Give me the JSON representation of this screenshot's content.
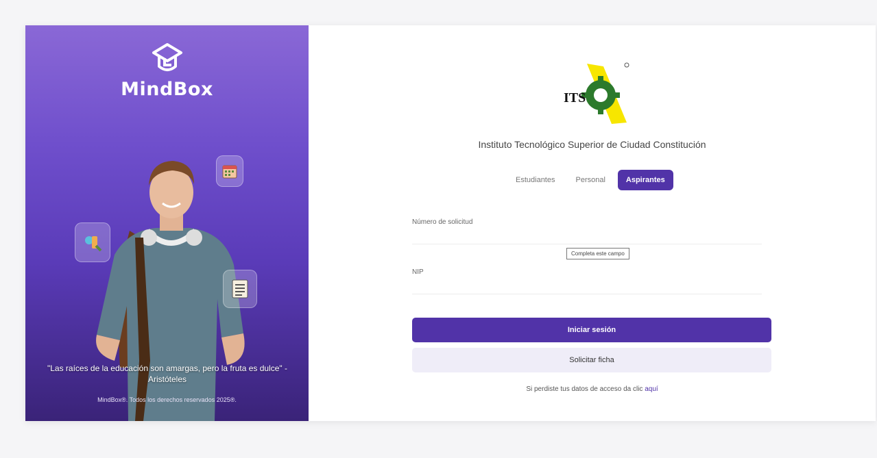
{
  "brand": {
    "name": "MindBox",
    "icon": "graduation-cap-icon"
  },
  "left_panel": {
    "quote": "\"Las raíces de la educación son amargas, pero la fruta es dulce\" - Aristóteles",
    "copyright": "MindBox®. Todos los derechos reservados 2025®.",
    "floating_icons": [
      "calendar-icon",
      "tools-icon",
      "checklist-icon"
    ]
  },
  "institution": {
    "logo_text": "ITS",
    "name": "Instituto Tecnológico Superior de Ciudad Constitución"
  },
  "tabs": [
    {
      "label": "Estudiantes",
      "active": false
    },
    {
      "label": "Personal",
      "active": false
    },
    {
      "label": "Aspirantes",
      "active": true
    }
  ],
  "form": {
    "solicitud_label": "Número de solicitud",
    "solicitud_value": "",
    "nip_label": "NIP",
    "nip_value": "",
    "tooltip": "Completa este campo"
  },
  "buttons": {
    "login": "Iniciar sesión",
    "request": "Solicitar ficha"
  },
  "forgot": {
    "text": "Si perdiste tus datos de acceso da clic ",
    "link": "aquí"
  },
  "colors": {
    "primary": "#5133a8",
    "panel_top": "#8a68d6",
    "panel_bottom": "#3a2378",
    "secondary_button": "#efedf8"
  }
}
